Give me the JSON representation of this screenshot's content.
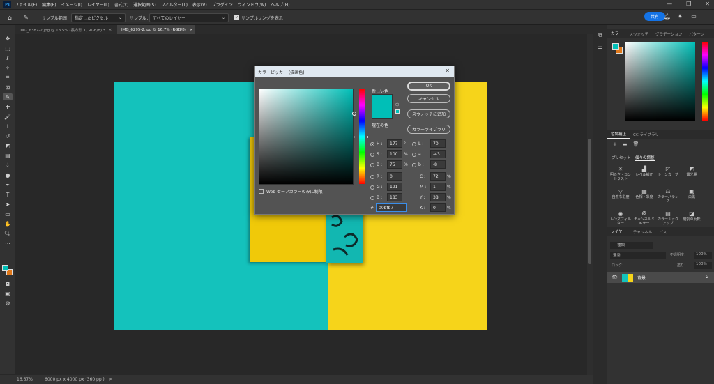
{
  "app": {
    "logo": "Ps"
  },
  "menubar": {
    "items": [
      "ファイル(F)",
      "編集(E)",
      "イメージ(I)",
      "レイヤー(L)",
      "書式(Y)",
      "選択範囲(S)",
      "フィルター(T)",
      "表示(V)",
      "プラグイン",
      "ウィンドウ(W)",
      "ヘルプ(H)"
    ],
    "minimize": "—",
    "maximize": "❐",
    "close": "✕"
  },
  "options": {
    "sample_size_label": "サンプル範囲：",
    "sample_size_value": "指定したピクセル",
    "sample_label": "サンプル：",
    "sample_value": "すべてのレイヤー",
    "show_ring": "サンプルリングを表示",
    "share": "共有"
  },
  "tabs": [
    {
      "label": "IMG_6387-2.jpg @ 18.5% (長方形 1, RGB/8) *",
      "close": "×"
    },
    {
      "label": "IMG_6295-2.jpg @ 16.7% (RGB/8)",
      "close": "×"
    }
  ],
  "status": {
    "zoom": "16.67%",
    "doc": "6000 px x 4000 px (360 ppi)",
    "arrow": ">"
  },
  "color_panel": {
    "tabs": [
      "カラー",
      "スウォッチ",
      "グラデーション",
      "パターン"
    ],
    "fg": "#00bfb7",
    "bg": "#e0781a"
  },
  "adjust_panel": {
    "tabs": [
      "色調補正",
      "CC ライブラリ"
    ],
    "subtabs": [
      "プリセット",
      "個々の調整"
    ],
    "items": [
      "明るさ・コントラスト",
      "レベル補正",
      "トーンカーブ",
      "露光量",
      "自然な彩度",
      "色相・彩度",
      "カラーバランス",
      "白黒",
      "レンズフィルター",
      "チャンネルミキサー",
      "カラールックアップ",
      "階調の反転"
    ]
  },
  "layers_panel": {
    "tabs": [
      "レイヤー",
      "チャンネル",
      "パス"
    ],
    "kind": "種類",
    "mode": "通常",
    "opacity_label": "不透明度：",
    "opacity": "100%",
    "lock": "ロック：",
    "fill_label": "塗り：",
    "fill": "100%",
    "layer_name": "背景"
  },
  "dialog": {
    "title": "カラーピッカー (描画色)",
    "close": "✕",
    "new_label": "新しい色",
    "current_label": "現在の色",
    "ok": "OK",
    "cancel": "キャンセル",
    "add_swatch": "スウォッチに追加",
    "libraries": "カラーライブラリ",
    "web_only": "Web セーフカラーのみに制限",
    "new_color": "#00bfb7",
    "current_color": "#00bfb7",
    "fields": {
      "H": {
        "label": "H :",
        "value": "177",
        "unit": "°"
      },
      "S": {
        "label": "S :",
        "value": "100",
        "unit": "%"
      },
      "B": {
        "label": "B :",
        "value": "75",
        "unit": "%"
      },
      "R": {
        "label": "R :",
        "value": "0"
      },
      "G": {
        "label": "G :",
        "value": "191"
      },
      "Bl": {
        "label": "B :",
        "value": "183"
      },
      "L": {
        "label": "L :",
        "value": "70"
      },
      "a": {
        "label": "a :",
        "value": "-43"
      },
      "b": {
        "label": "b :",
        "value": "-8"
      },
      "C": {
        "label": "C :",
        "value": "72",
        "unit": "%"
      },
      "M": {
        "label": "M :",
        "value": "1",
        "unit": "%"
      },
      "Y": {
        "label": "Y :",
        "value": "38",
        "unit": "%"
      },
      "K": {
        "label": "K :",
        "value": "0",
        "unit": "%"
      }
    },
    "hex_label": "#",
    "hex": "00bfb7"
  }
}
